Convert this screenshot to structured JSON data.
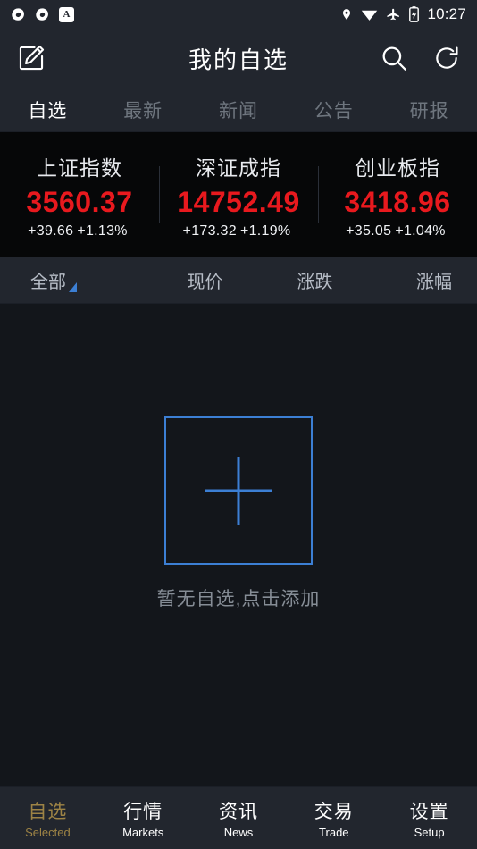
{
  "statusbar": {
    "time": "10:27",
    "left_icons": [
      {
        "name": "sync-icon-1"
      },
      {
        "name": "sync-icon-2"
      },
      {
        "name": "app-badge-icon",
        "label": "A"
      }
    ],
    "right_icons": [
      {
        "name": "location-pin-icon"
      },
      {
        "name": "wifi-icon"
      },
      {
        "name": "airplane-mode-icon"
      },
      {
        "name": "battery-charging-icon"
      }
    ]
  },
  "header": {
    "title": "我的自选",
    "edit_icon": "edit-icon",
    "search_icon": "search-icon",
    "refresh_icon": "refresh-icon"
  },
  "tabs": [
    {
      "label": "自选",
      "active": true
    },
    {
      "label": "最新",
      "active": false
    },
    {
      "label": "新闻",
      "active": false
    },
    {
      "label": "公告",
      "active": false
    },
    {
      "label": "研报",
      "active": false
    }
  ],
  "indexes": [
    {
      "name": "上证指数",
      "value": "3560.37",
      "change": "+39.66",
      "percent": "+1.13%"
    },
    {
      "name": "深证成指",
      "value": "14752.49",
      "change": "+173.32",
      "percent": "+1.19%"
    },
    {
      "name": "创业板指",
      "value": "3418.96",
      "change": "+35.05",
      "percent": "+1.04%"
    }
  ],
  "columns": {
    "filter": "全部",
    "price": "现价",
    "change": "涨跌",
    "percent": "涨幅"
  },
  "empty_state": {
    "message": "暂无自选,点击添加",
    "icon": "plus-box-icon"
  },
  "bottom_nav": [
    {
      "cn": "自选",
      "en": "Selected",
      "active": true
    },
    {
      "cn": "行情",
      "en": "Markets",
      "active": false
    },
    {
      "cn": "资讯",
      "en": "News",
      "active": false
    },
    {
      "cn": "交易",
      "en": "Trade",
      "active": false
    },
    {
      "cn": "设置",
      "en": "Setup",
      "active": false
    }
  ],
  "colors": {
    "accent_gold": "#9d8345",
    "accent_blue": "#3c7fd4",
    "up_red": "#e8191e",
    "bar_bg": "#22262e",
    "content_bg": "#13161b"
  }
}
